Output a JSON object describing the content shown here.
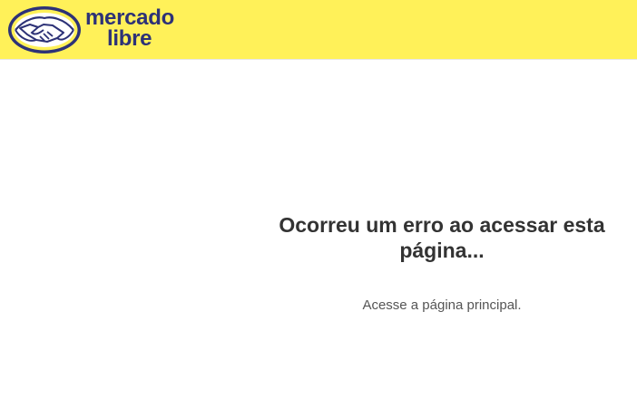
{
  "header": {
    "brand_line1": "mercado",
    "brand_line2": "libre",
    "logo_icon": "handshake-icon",
    "background_color": "#fff159",
    "brand_color": "#2d3277"
  },
  "main": {
    "error_title": "Ocorreu um erro ao acessar esta página...",
    "home_link_label": "Acesse a página principal."
  }
}
